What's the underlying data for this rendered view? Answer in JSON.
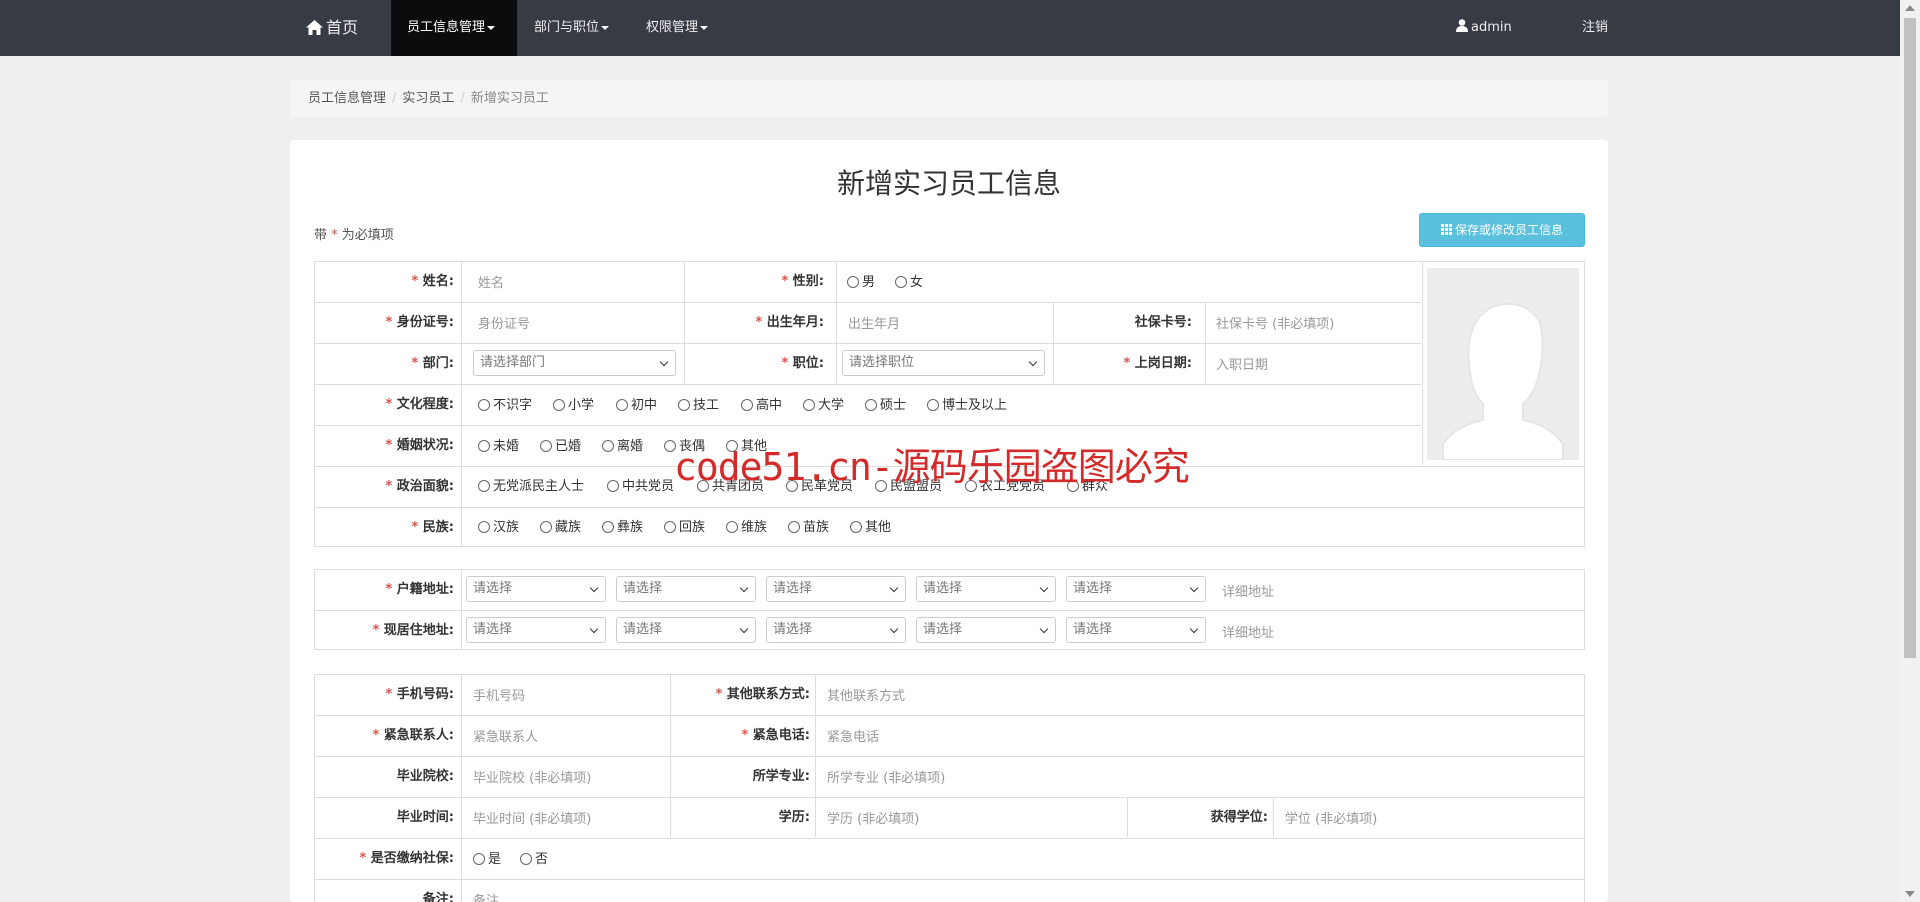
{
  "nav": {
    "home": "首页",
    "employee": "员工信息管理",
    "dept": "部门与职位",
    "auth": "权限管理",
    "user": "admin",
    "logout": "注销"
  },
  "breadcrumb": [
    "员工信息管理",
    "实习员工",
    "新增实习员工"
  ],
  "page": {
    "title": "新增实习员工信息",
    "hint_prefix": "带",
    "hint_star": "*",
    "hint_suffix": "为必填项",
    "save_button": "保存或修改员工信息"
  },
  "form": {
    "star": "*",
    "name_label": "姓名:",
    "name_placeholder": "姓名",
    "gender_label": "性别:",
    "gender_options": [
      "男",
      "女"
    ],
    "idcard_label": "身份证号:",
    "idcard_placeholder": "身份证号",
    "birth_label": "出生年月:",
    "birth_placeholder": "出生年月",
    "social_card_label": "社保卡号:",
    "social_card_placeholder": "社保卡号 (非必填项)",
    "dept_label": "部门:",
    "dept_select": "请选择部门",
    "position_label": "职位:",
    "position_select": "请选择职位",
    "hire_label": "上岗日期:",
    "hire_placeholder": "入职日期",
    "education_label": "文化程度:",
    "education_options": [
      "不识字",
      "小学",
      "初中",
      "技工",
      "高中",
      "大学",
      "硕士",
      "博士及以上"
    ],
    "marriage_label": "婚姻状况:",
    "marriage_options": [
      "未婚",
      "已婚",
      "离婚",
      "丧偶",
      "其他"
    ],
    "politics_label": "政治面貌:",
    "politics_options": [
      "无党派民主人士",
      "中共党员",
      "共青团员",
      "民革党员",
      "民盟盟员",
      "农工党党员",
      "群众"
    ],
    "nation_label": "民族:",
    "nation_options": [
      "汉族",
      "藏族",
      "彝族",
      "回族",
      "维族",
      "苗族",
      "其他"
    ],
    "hukou_label": "户籍地址:",
    "residence_label": "现居住地址:",
    "select_placeholder": "请选择",
    "address_placeholder": "详细地址",
    "phone_label": "手机号码:",
    "phone_placeholder": "手机号码",
    "other_contact_label": "其他联系方式:",
    "other_contact_placeholder": "其他联系方式",
    "emergency_contact_label": "紧急联系人:",
    "emergency_contact_placeholder": "紧急联系人",
    "emergency_phone_label": "紧急电话:",
    "emergency_phone_placeholder": "紧急电话",
    "school_label": "毕业院校:",
    "school_placeholder": "毕业院校 (非必填项)",
    "major_label": "所学专业:",
    "major_placeholder": "所学专业 (非必填项)",
    "grad_time_label": "毕业时间:",
    "grad_time_placeholder": "毕业时间 (非必填项)",
    "degree_label": "学历:",
    "degree_placeholder": "学历 (非必填项)",
    "academic_degree_label": "获得学位:",
    "academic_degree_placeholder": "学位 (非必填项)",
    "social_insurance_label": "是否缴纳社保:",
    "social_insurance_options": [
      "是",
      "否"
    ],
    "remark_label": "备注:",
    "remark_placeholder": "备注"
  },
  "watermark": "code51.cn-源码乐园盗图必究",
  "colors": {
    "navbar": "#373b44",
    "active_nav": "#0b0c0e",
    "save_button": "#5bc0de",
    "required": "#d9534f",
    "watermark": "#d42a2a"
  }
}
